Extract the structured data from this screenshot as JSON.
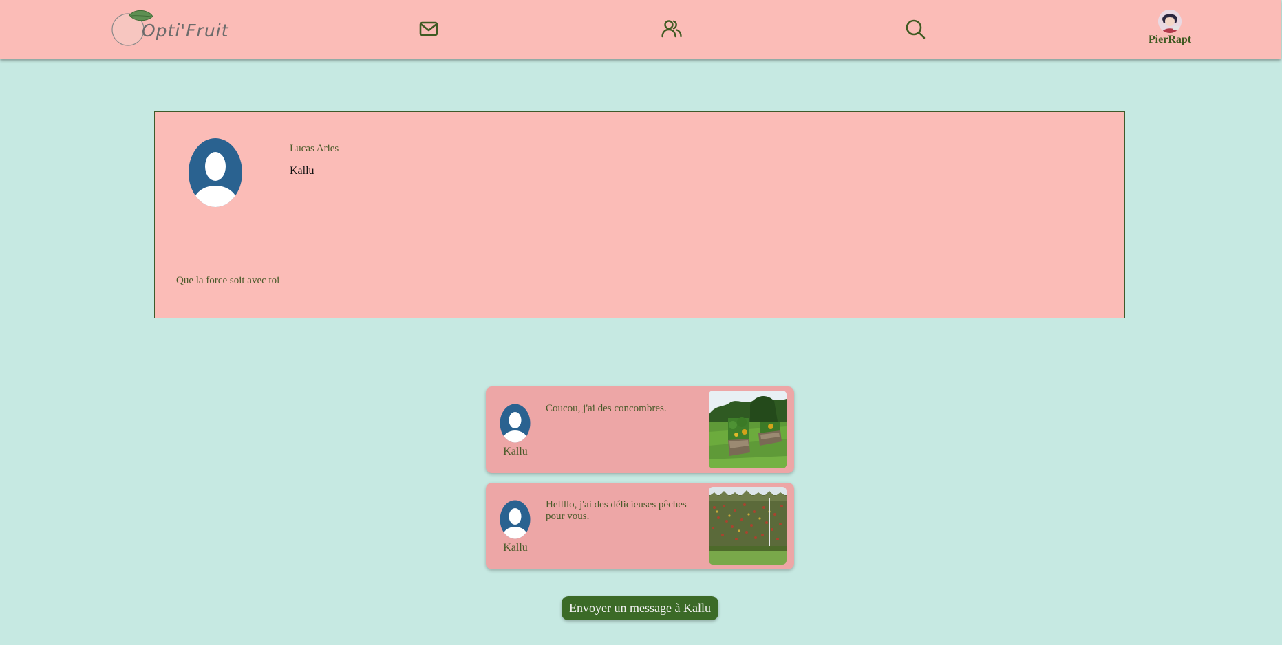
{
  "brand": {
    "logo_text": "Opti'Fruit"
  },
  "nav": {
    "icons": [
      "mail-icon",
      "users-icon",
      "search-icon"
    ],
    "user": {
      "name": "PierRapt"
    }
  },
  "profile": {
    "real_name": "Lucas Aries",
    "username": "Kallu",
    "bio": "Que la force soit avec toi"
  },
  "posts": [
    {
      "author": "Kallu",
      "text": "Coucou, j'ai des concombres."
    },
    {
      "author": "Kallu",
      "text": "Hellllo, j'ai des délicieuses pêches pour vous."
    }
  ],
  "actions": {
    "send_message_label": "Envoyer un message à Kallu"
  },
  "colors": {
    "background": "#c6e9e2",
    "navbar": "#fbbcb7",
    "card": "#fbbcb7",
    "post": "#eda6a6",
    "accent_green": "#3b6a27",
    "icon_green": "#3f5a22",
    "avatar_blue": "#2a6290"
  }
}
